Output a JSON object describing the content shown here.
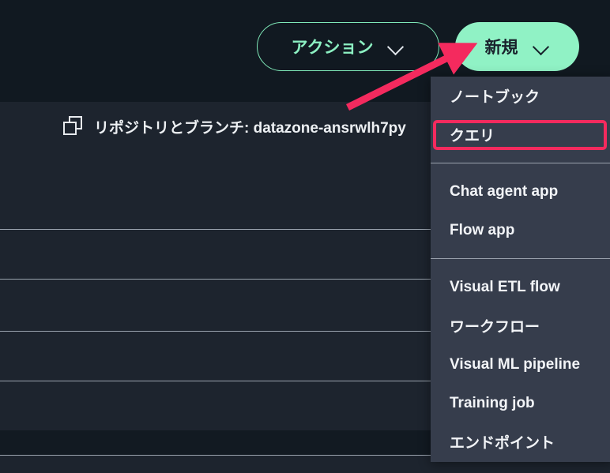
{
  "header": {
    "actions_button": {
      "label": "アクション",
      "icon": "chevron-down-icon"
    },
    "new_button": {
      "label": "新規",
      "icon": "chevron-down-icon"
    }
  },
  "repository_bar": {
    "icon": "copy-icon",
    "text": "リポジトリとブランチ: datazone-ansrwlh7py"
  },
  "dropdown_menu": {
    "groups": [
      {
        "items": [
          {
            "label": "ノートブック",
            "highlighted": false
          },
          {
            "label": "クエリ",
            "highlighted": true
          }
        ]
      },
      {
        "items": [
          {
            "label": "Chat agent app",
            "highlighted": false
          },
          {
            "label": "Flow app",
            "highlighted": false
          }
        ]
      },
      {
        "items": [
          {
            "label": "Visual ETL flow",
            "highlighted": false
          },
          {
            "label": "ワークフロー",
            "highlighted": false
          },
          {
            "label": "Visual ML pipeline",
            "highlighted": false
          },
          {
            "label": "Training job",
            "highlighted": false
          },
          {
            "label": "エンドポイント",
            "highlighted": false
          }
        ]
      }
    ]
  },
  "annotations": {
    "arrow": {
      "color": "#f42a5e",
      "points_to": "新規"
    },
    "highlight": {
      "color": "#f42a5e",
      "target": "クエリ"
    }
  },
  "colors": {
    "header_bg": "#111921",
    "panel_bg": "#1d242e",
    "dropdown_bg": "#363d4c",
    "accent_mint": "#90f2c5",
    "annotation_red": "#f42a5e",
    "divider": "#99a2ad",
    "dark_band": "#121a22"
  }
}
